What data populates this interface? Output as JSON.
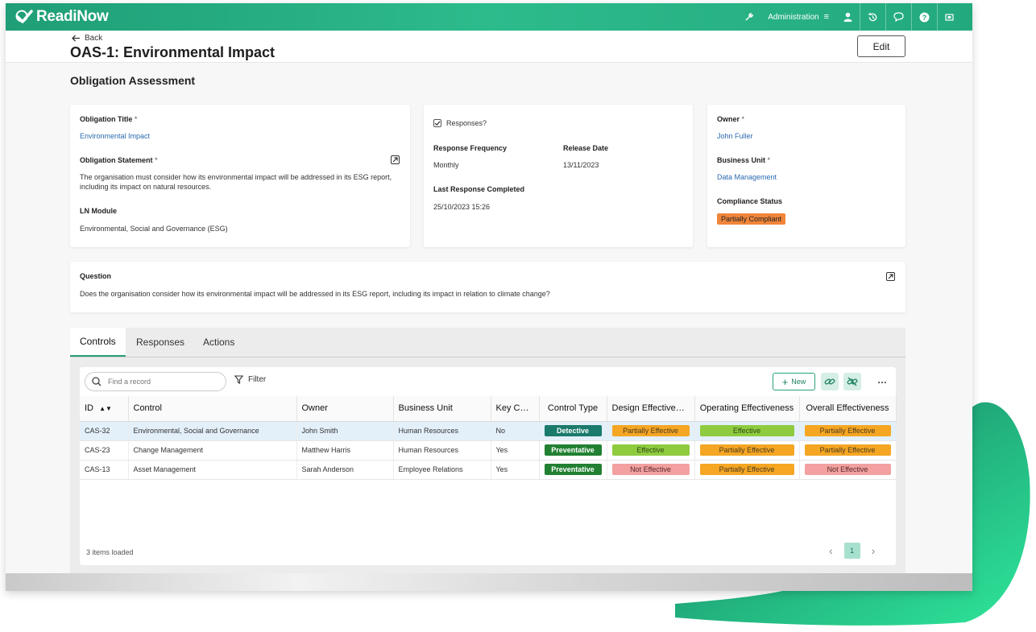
{
  "app": {
    "name": "ReadiNow"
  },
  "topbar": {
    "admin_label": "Administration"
  },
  "header": {
    "back_label": "Back",
    "title": "OAS-1: Environmental Impact",
    "edit_label": "Edit"
  },
  "section": {
    "title": "Obligation Assessment"
  },
  "card1": {
    "title_label": "Obligation Title",
    "title_value": "Environmental Impact",
    "statement_label": "Obligation Statement",
    "statement_value": "The organisation must consider how its environmental impact will be addressed in its ESG report, including its impact on natural resources.",
    "module_label": "LN Module",
    "module_value": "Environmental, Social and Governance (ESG)",
    "required_mark": "*"
  },
  "card2": {
    "responses_label": "Responses?",
    "frequency_label": "Response Frequency",
    "frequency_value": "Monthly",
    "release_label": "Release Date",
    "release_value": "13/11/2023",
    "last_label": "Last Response Completed",
    "last_value": "25/10/2023 15:26"
  },
  "card3": {
    "owner_label": "Owner",
    "owner_value": "John Fuller",
    "unit_label": "Business Unit",
    "unit_value": "Data Management",
    "status_label": "Compliance Status",
    "status_value": "Partially Compliant"
  },
  "question": {
    "label": "Question",
    "text": "Does the organisation consider how its environmental impact will be addressed in its ESG report, including its impact in relation to climate change?"
  },
  "tabs": [
    {
      "label": "Controls"
    },
    {
      "label": "Responses"
    },
    {
      "label": "Actions"
    }
  ],
  "toolbar": {
    "search_placeholder": "Find a record",
    "filter_label": "Filter",
    "new_label": "New",
    "more_label": "…"
  },
  "table": {
    "columns": [
      "ID",
      "Control",
      "Owner",
      "Business Unit",
      "Key Con...",
      "Control Type",
      "Design Effectivene...",
      "Operating Effectiveness",
      "Overall Effectiveness"
    ],
    "rows": [
      {
        "id": "CAS-32",
        "control": "Environmental, Social and Governance",
        "owner": "John Smith",
        "unit": "Human Resources",
        "key": "No",
        "type": "Detective",
        "design": "Partially Effective",
        "operating": "Effective",
        "overall": "Partially Effective"
      },
      {
        "id": "CAS-23",
        "control": "Change Management",
        "owner": "Matthew Harris",
        "unit": "Human Resources",
        "key": "Yes",
        "type": "Preventative",
        "design": "Effective",
        "operating": "Partially Effective",
        "overall": "Partially Effective"
      },
      {
        "id": "CAS-13",
        "control": "Asset Management",
        "owner": "Sarah Anderson",
        "unit": "Employee Relations",
        "key": "Yes",
        "type": "Preventative",
        "design": "Not Effective",
        "operating": "Partially Effective",
        "overall": "Not Effective"
      }
    ],
    "footer": "3 items loaded",
    "page": "1"
  },
  "colors": {
    "brand": "#2dbb8c",
    "detective": "#1a7a6c",
    "preventative": "#228032",
    "partially": "#f5a623",
    "effective": "#8fcb3f",
    "not_effective": "#f2a0a0",
    "compliance": "#f0863a"
  }
}
